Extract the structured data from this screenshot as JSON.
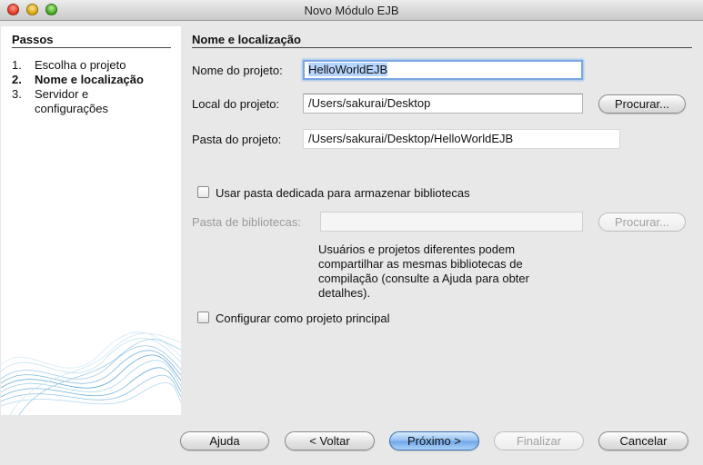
{
  "window": {
    "title": "Novo Módulo EJB"
  },
  "steps": {
    "title": "Passos",
    "items": [
      {
        "num": "1.",
        "label": "Escolha o projeto",
        "cont": ""
      },
      {
        "num": "2.",
        "label": "Nome e localização",
        "cont": ""
      },
      {
        "num": "3.",
        "label": "Servidor e",
        "cont": "configurações"
      }
    ]
  },
  "section": {
    "title": "Nome e localização"
  },
  "form": {
    "project_name_label": "Nome do projeto:",
    "project_name_value": "HelloWorldEJB",
    "project_location_label": "Local do projeto:",
    "project_location_value": "/Users/sakurai/Desktop",
    "browse_label": "Procurar...",
    "project_folder_label": "Pasta do projeto:",
    "project_folder_value": "/Users/sakurai/Desktop/HelloWorldEJB",
    "dedicated_folder_label": "Usar pasta dedicada para armazenar bibliotecas",
    "libraries_folder_label": "Pasta de bibliotecas:",
    "libraries_folder_value": "",
    "browse_disabled_label": "Procurar...",
    "note_line1": "Usuários e projetos diferentes podem",
    "note_line2": "compartilhar as mesmas bibliotecas de",
    "note_line3": "compilação (consulte a Ajuda para obter",
    "note_line4": "detalhes).",
    "main_project_label": "Configurar como projeto principal"
  },
  "buttons": {
    "help": "Ajuda",
    "back": "< Voltar",
    "next": "Próximo >",
    "finish": "Finalizar",
    "cancel": "Cancelar"
  }
}
